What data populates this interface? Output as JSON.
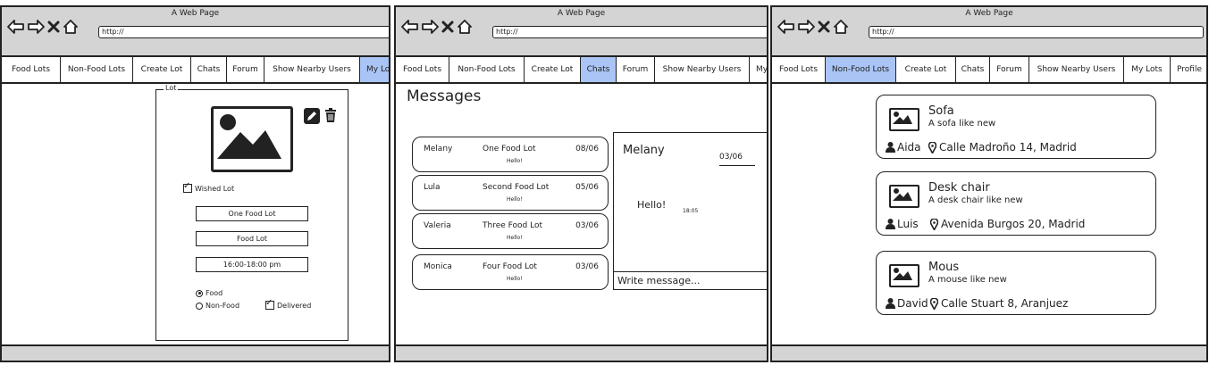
{
  "browser": {
    "title": "A Web Page",
    "url": "http://"
  },
  "windows": [
    {
      "menu": [
        {
          "label": "Food Lots",
          "active": false
        },
        {
          "label": "Non-Food Lots",
          "active": false
        },
        {
          "label": "Create Lot",
          "active": false
        },
        {
          "label": "Chats",
          "active": false
        },
        {
          "label": "Forum",
          "active": false
        },
        {
          "label": "Show Nearby Users",
          "active": false
        },
        {
          "label": "My Lots",
          "active": true
        }
      ],
      "lot_form": {
        "group_label": "Lot",
        "wished_label": "Wished Lot",
        "fields": [
          "One Food Lot",
          "Food Lot",
          "16:00-18:00 pm"
        ],
        "radio_food": "Food",
        "radio_nonfood": "Non-Food",
        "delivered_label": "Delivered"
      }
    },
    {
      "menu": [
        {
          "label": "Food Lots",
          "active": false
        },
        {
          "label": "Non-Food Lots",
          "active": false
        },
        {
          "label": "Create Lot",
          "active": false
        },
        {
          "label": "Chats",
          "active": true
        },
        {
          "label": "Forum",
          "active": false
        },
        {
          "label": "Show Nearby Users",
          "active": false
        },
        {
          "label": "My Lots",
          "active": false
        }
      ],
      "messages_title": "Messages",
      "conversations": [
        {
          "name": "Melany",
          "lot": "One Food Lot",
          "date": "08/06",
          "preview": "Hello!"
        },
        {
          "name": "Lula",
          "lot": "Second Food Lot",
          "date": "05/06",
          "preview": "Hello!"
        },
        {
          "name": "Valeria",
          "lot": "Three Food Lot",
          "date": "03/06",
          "preview": "Hello!"
        },
        {
          "name": "Monica",
          "lot": "Four Food Lot",
          "date": "03/06",
          "preview": "Hello!"
        }
      ],
      "chat": {
        "name": "Melany",
        "date": "03/06",
        "message": "Hello!",
        "time": "18:05",
        "input_placeholder": "Write message..."
      }
    },
    {
      "menu": [
        {
          "label": "Food Lots",
          "active": false
        },
        {
          "label": "Non-Food Lots",
          "active": true
        },
        {
          "label": "Create Lot",
          "active": false
        },
        {
          "label": "Chats",
          "active": false
        },
        {
          "label": "Forum",
          "active": false
        },
        {
          "label": "Show Nearby Users",
          "active": false
        },
        {
          "label": "My Lots",
          "active": false
        },
        {
          "label": "Profile",
          "active": false
        }
      ],
      "lots": [
        {
          "title": "Sofa",
          "desc": "A sofa like new",
          "user": "Aida",
          "address": "Calle Madroño 14, Madrid"
        },
        {
          "title": "Desk chair",
          "desc": "A desk chair like new",
          "user": "Luis",
          "address": "Avenida Burgos 20, Madrid"
        },
        {
          "title": "Mous",
          "desc": "A mouse like new",
          "user": "David",
          "address": "Calle Stuart 8, Aranjuez"
        }
      ]
    }
  ],
  "colors": {
    "active_tab": "#a9c4f5",
    "chrome": "#d4d4d4"
  }
}
